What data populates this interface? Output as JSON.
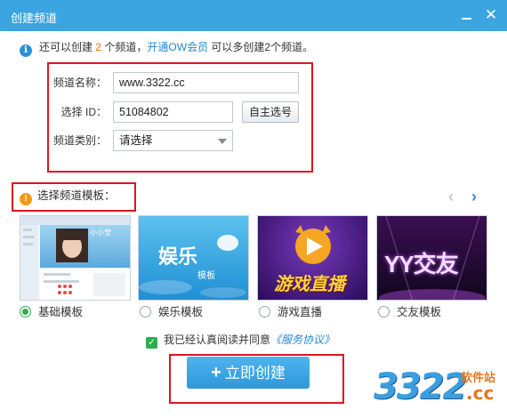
{
  "window": {
    "title": "创建频道",
    "close_glyph": "✕"
  },
  "info": {
    "icon": "i",
    "prefix": "还可以创建",
    "count": "2",
    "middle": "个频道，",
    "link_text": "开通OW会员",
    "suffix": "可以多创建2个频道。"
  },
  "form": {
    "name_label": "频道名称：",
    "name_value": "www.3322.cc",
    "id_label": "选择 ID：",
    "id_value": "51084802",
    "id_button": "自主选号",
    "category_label": "频道类别：",
    "category_value": "请选择"
  },
  "templates": {
    "heading": "选择频道模板：",
    "warn_icon": "!",
    "prev_glyph": "‹",
    "next_glyph": "›",
    "items": [
      {
        "label": "基础模板",
        "selected": true,
        "preview_name": "小小莹"
      },
      {
        "label": "娱乐模板",
        "selected": false,
        "preview_main": "娱乐",
        "preview_sub": "模板"
      },
      {
        "label": "游戏直播",
        "selected": false,
        "preview_main": "游戏直播"
      },
      {
        "label": "交友模板",
        "selected": false,
        "preview_main": "YY交友"
      }
    ]
  },
  "agreement": {
    "text": "我已经认真阅读并同意",
    "link": "《服务协议》",
    "checked": true
  },
  "create_button": {
    "plus": "+",
    "label": "立即创建"
  },
  "watermark": {
    "digits": "3322",
    "site": "软件站",
    "domain": ".cc"
  },
  "colors": {
    "title_bar": "#3aa5e0",
    "highlight_box": "#e0141e",
    "accent_orange": "#ff6a00",
    "link_blue": "#1e88d2",
    "selected_green": "#2fae4f"
  }
}
